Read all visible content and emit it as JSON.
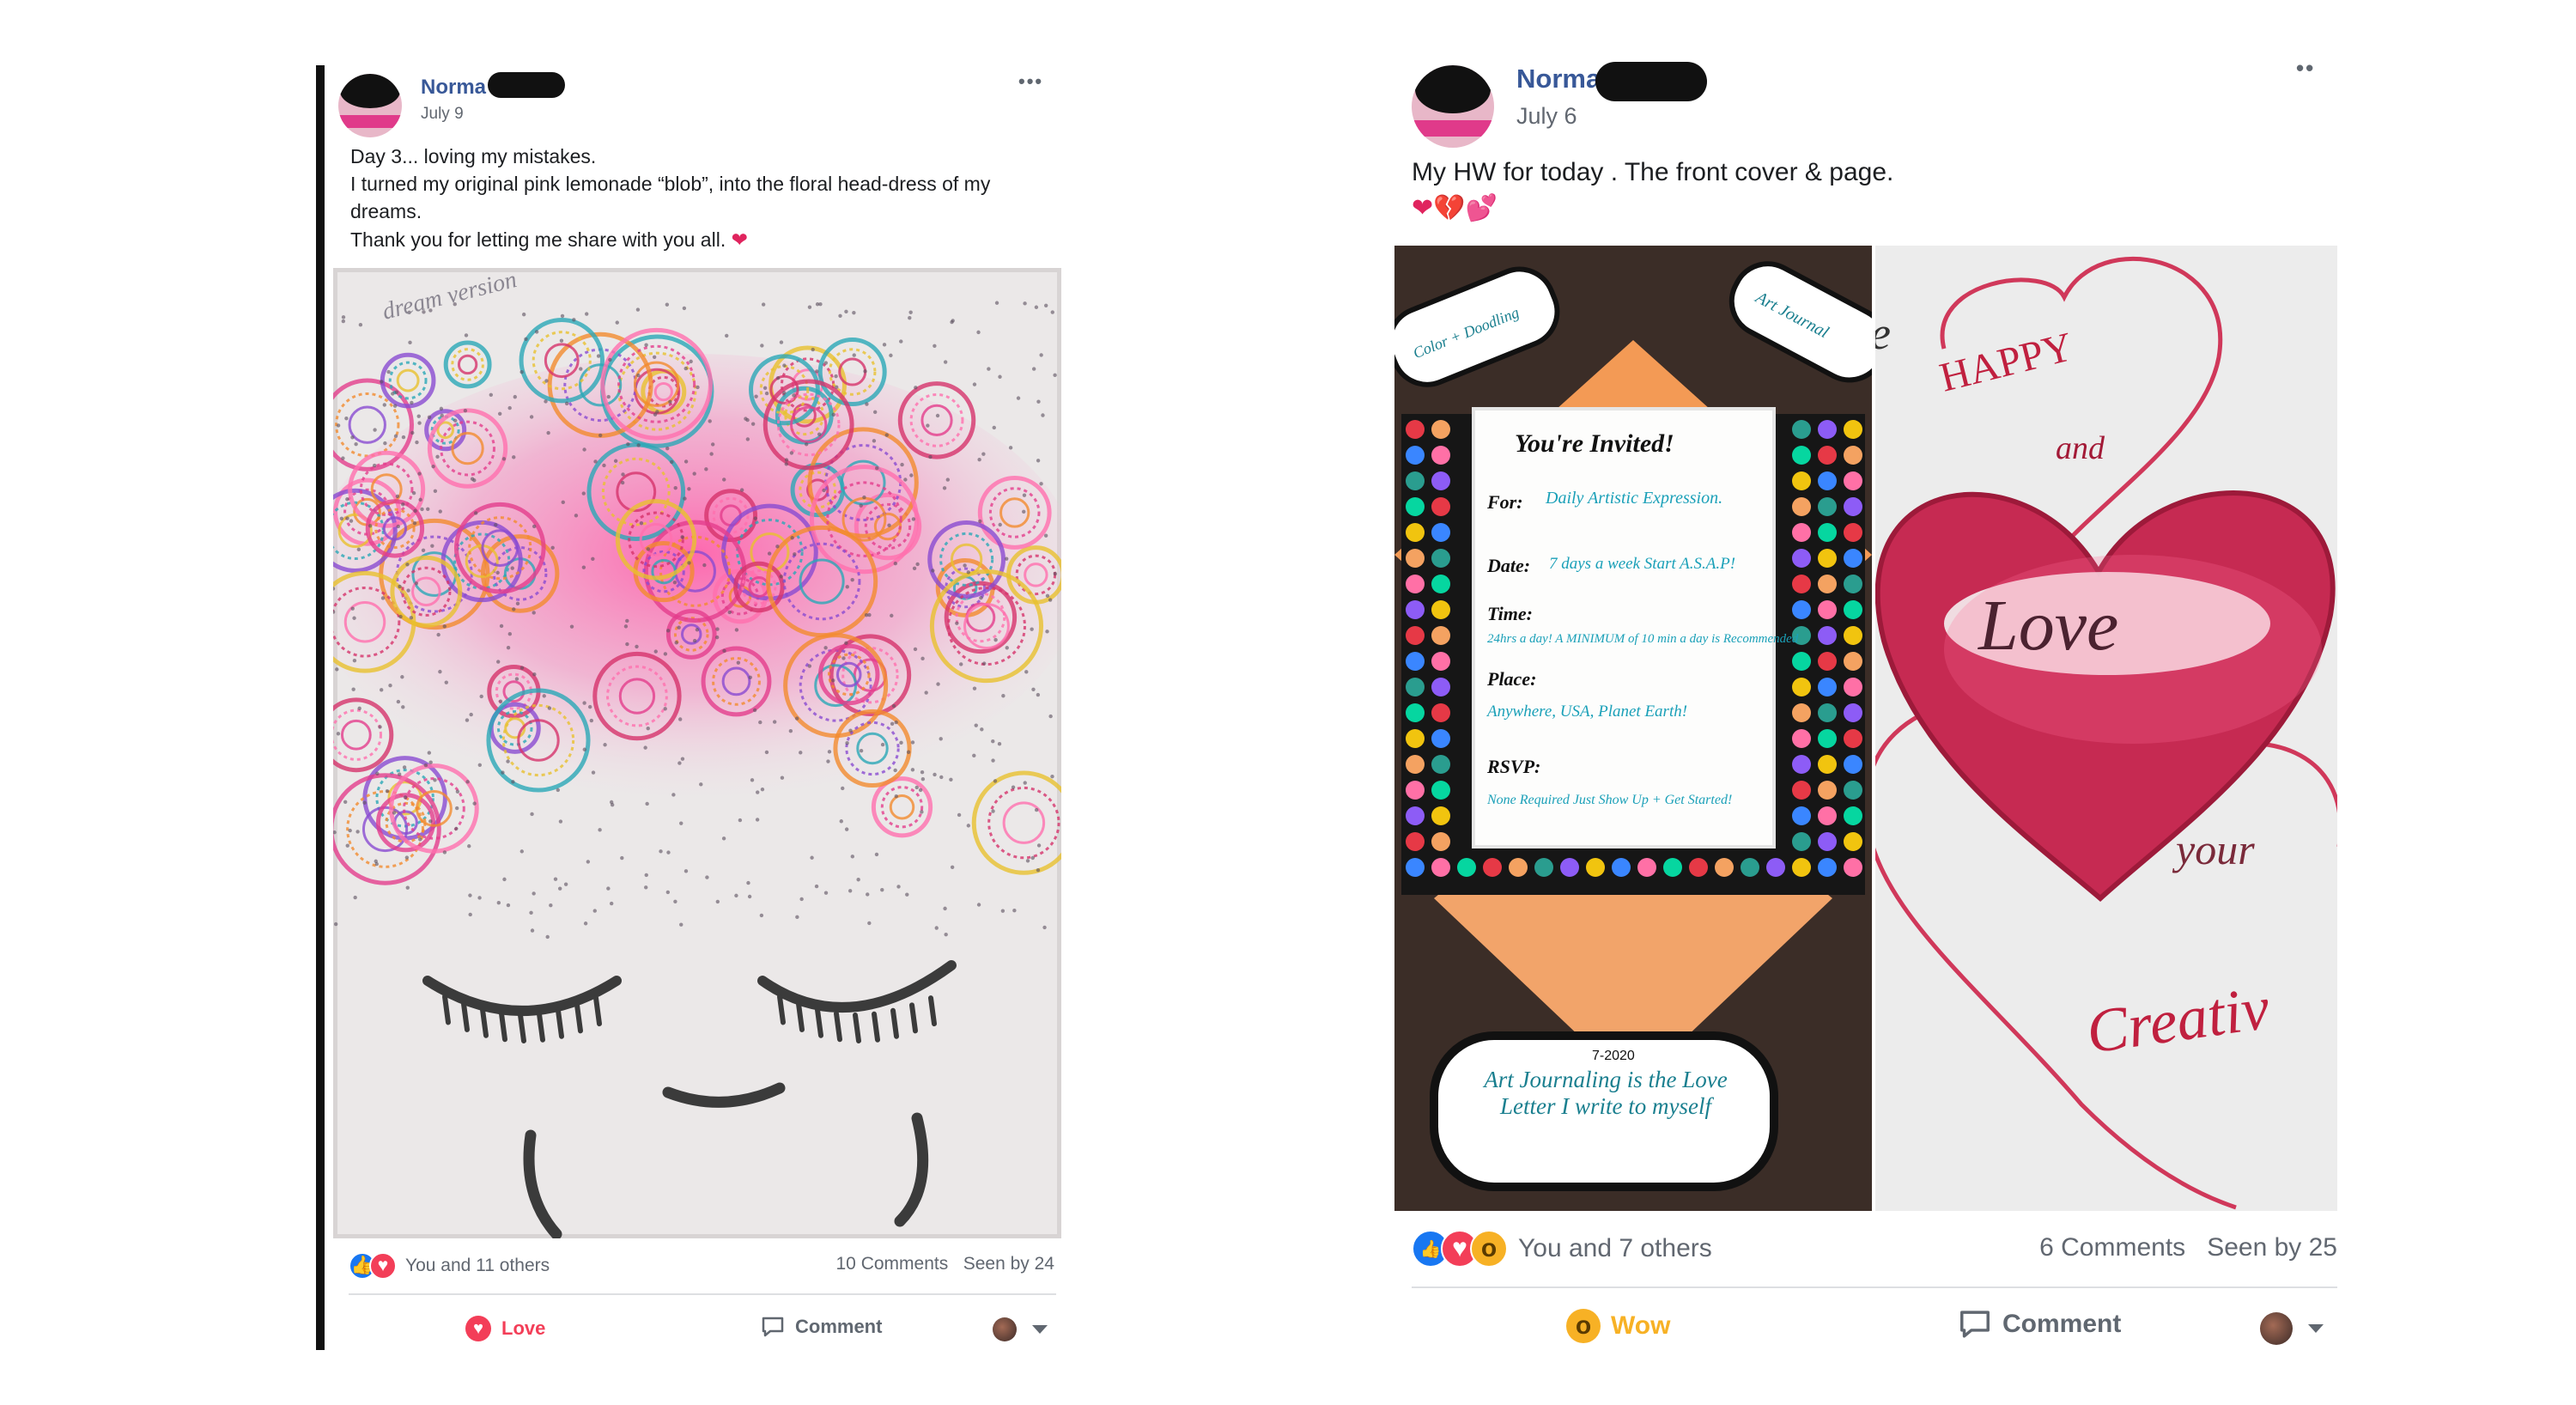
{
  "post_left": {
    "author": "Norma",
    "date": "July 9",
    "more_label": "•••",
    "caption_lines": [
      "Day 3... loving my mistakes.",
      "I turned my original pink lemonade “blob”, into the floral head-dress of my",
      "dreams.",
      "Thank you for letting me share with you all."
    ],
    "caption_emoji": "❤",
    "photo": {
      "handwriting": "dream version"
    },
    "reactions_text": "You and 11 others",
    "comments_text": "10 Comments",
    "seen_text": "Seen by 24",
    "action_love": "Love",
    "action_comment": "Comment"
  },
  "post_right": {
    "author": "Norma",
    "date": "July 6",
    "more_label": "••",
    "caption": "My HW for today . The front cover & page.",
    "emoji_line": "❤💔💕",
    "photo_left": {
      "top_left_label": "Color + Doodling",
      "top_right_label": "Art Journal",
      "invite_title": "You're Invited!",
      "for_label": "For:",
      "for_value": "Daily Artistic Expression.",
      "date_label": "Date:",
      "date_value": "7 days a week Start A.S.A.P!",
      "time_label": "Time:",
      "time_value": "24hrs a day! A MINIMUM of 10 min a day is Recommended",
      "place_label": "Place:",
      "place_value": "Anywhere, USA, Planet Earth!",
      "rsvp_label": "RSVP:",
      "rsvp_value": "None Required Just Show Up + Get Started!",
      "bottom_date": "7-2020",
      "bottom_text": "Art Journaling is the Love Letter I write to myself"
    },
    "photo_right": {
      "word1": "HAPPY",
      "word2": "and",
      "word3": "Love",
      "word4": "your",
      "word5": "Creativ",
      "partial": "e"
    },
    "reactions_text": "You and 7 others",
    "comments_text": "6 Comments",
    "seen_text": "Seen by 25",
    "action_wow": "Wow",
    "action_comment": "Comment"
  },
  "icons": {
    "like": "like-icon",
    "love": "love-icon",
    "wow": "wow-icon",
    "comment": "comment-icon"
  },
  "colors": {
    "author_link": "#385898",
    "love_red": "#f33e58",
    "wow_yellow": "#f7b125",
    "like_blue": "#1877f2"
  }
}
